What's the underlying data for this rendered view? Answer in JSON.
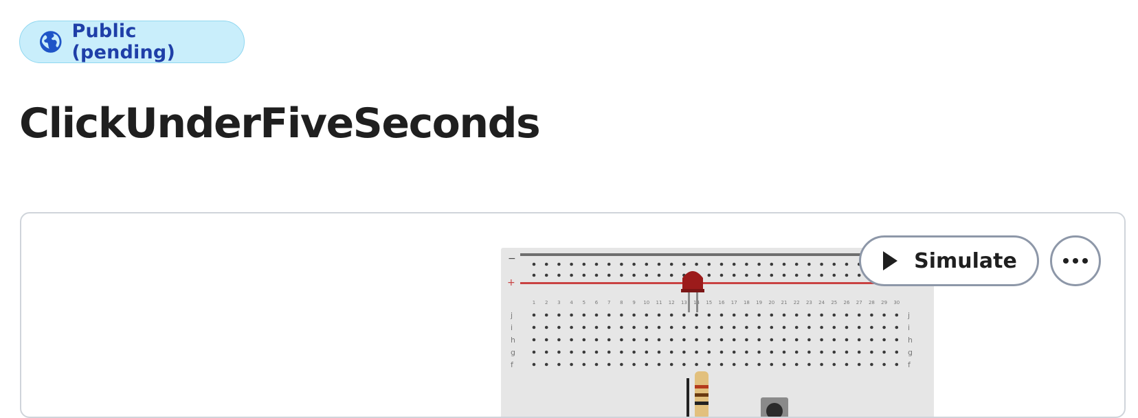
{
  "badge": {
    "label": "Public (pending)",
    "icon": "globe-icon",
    "color": "#1f3fa8",
    "background": "#c9eefb"
  },
  "page": {
    "title": "ClickUnderFiveSeconds"
  },
  "toolbar": {
    "simulate_label": "Simulate",
    "simulate_icon": "play-icon",
    "more_icon": "more-horizontal-icon"
  },
  "preview": {
    "description_icon": "breadboard-circuit-thumbnail",
    "rail_labels": [
      "−",
      "+"
    ],
    "column_numbers": [
      "1",
      "2",
      "3",
      "4",
      "5",
      "6",
      "7",
      "8",
      "9",
      "10",
      "11",
      "12",
      "13",
      "14",
      "15",
      "16",
      "17",
      "18",
      "19",
      "20",
      "21",
      "22",
      "23",
      "24",
      "25",
      "26",
      "27",
      "28",
      "29",
      "30"
    ],
    "row_letters": [
      "j",
      "i",
      "h",
      "g",
      "f"
    ]
  }
}
